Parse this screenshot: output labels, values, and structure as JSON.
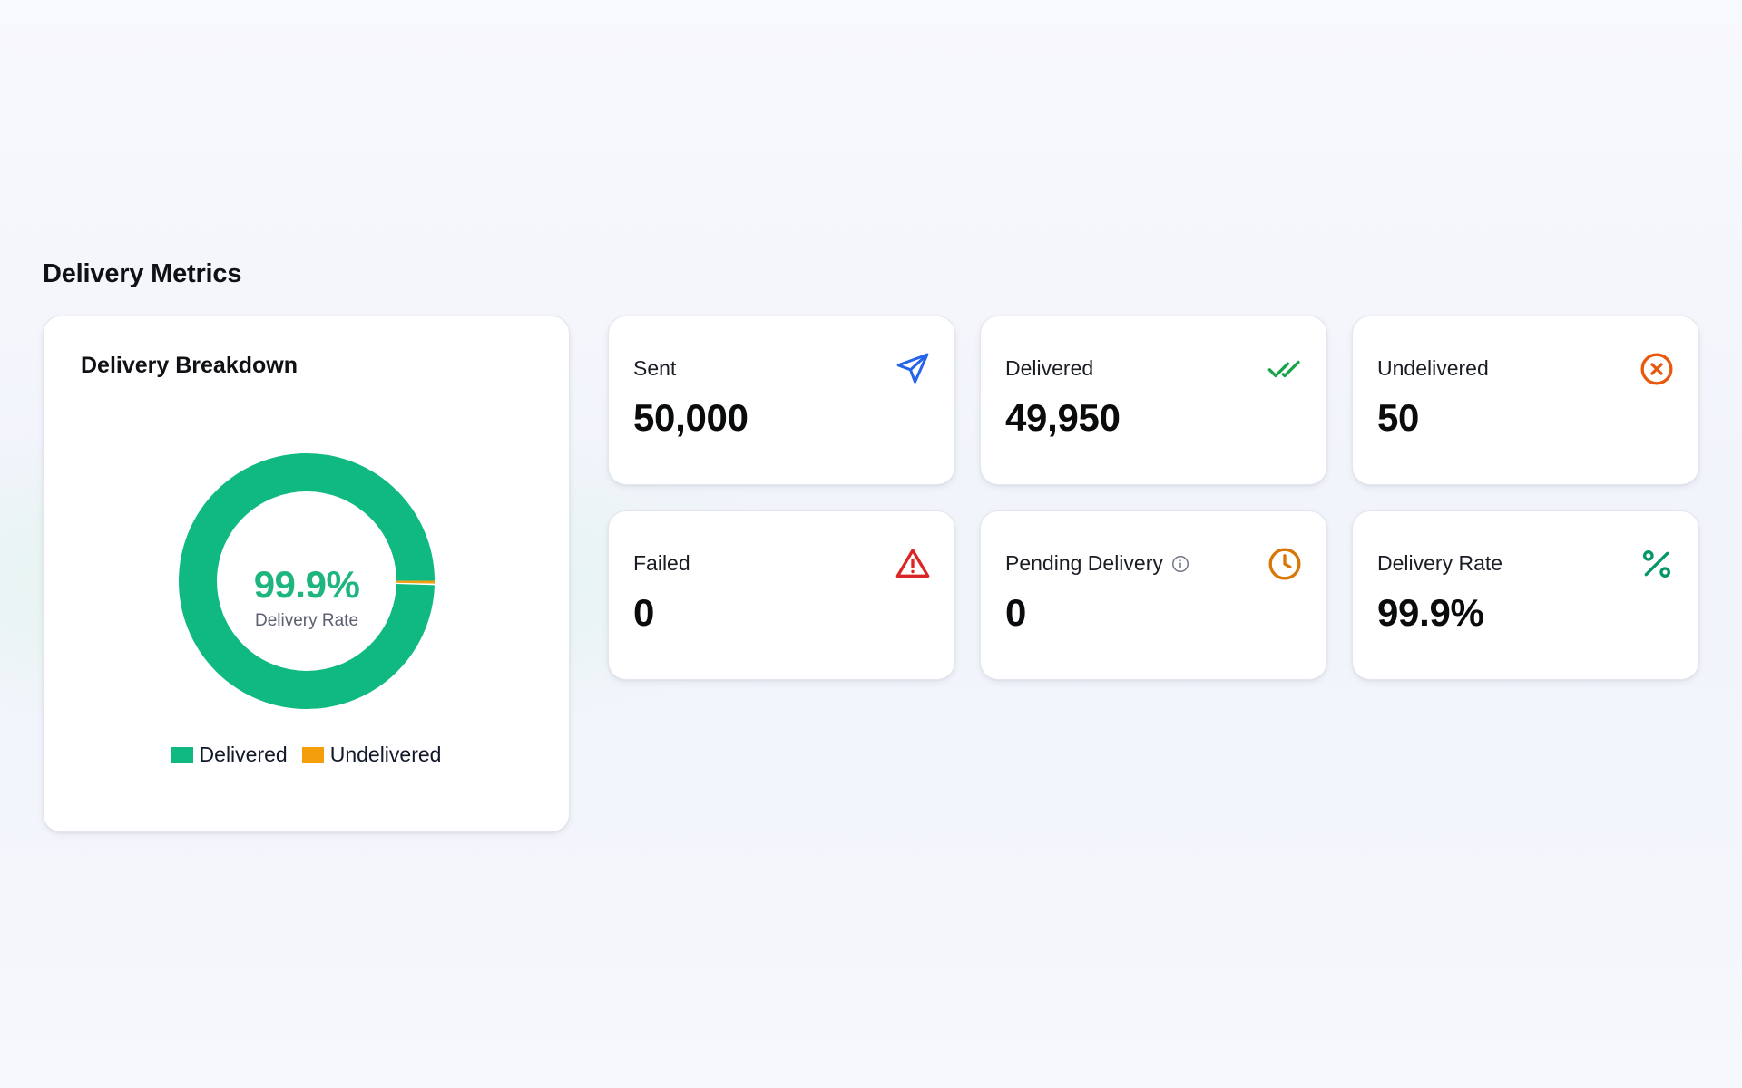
{
  "section": {
    "title": "Delivery Metrics"
  },
  "breakdown": {
    "title": "Delivery Breakdown",
    "center_value": "99.9%",
    "center_label": "Delivery Rate",
    "legend": [
      {
        "label": "Delivered",
        "color": "#10b981"
      },
      {
        "label": "Undelivered",
        "color": "#f59e0b"
      }
    ]
  },
  "chart_data": {
    "type": "pie",
    "categories": [
      "Delivered",
      "Undelivered"
    ],
    "values": [
      49950,
      50
    ],
    "colors": [
      "#10b981",
      "#f59e0b"
    ],
    "title": "Delivery Breakdown",
    "center_text": "99.9%",
    "center_subtext": "Delivery Rate",
    "legend_position": "bottom"
  },
  "stats": [
    {
      "label": "Sent",
      "value": "50,000",
      "icon": "send-icon",
      "color": "#2563eb"
    },
    {
      "label": "Delivered",
      "value": "49,950",
      "icon": "double-check-icon",
      "color": "#16a34a"
    },
    {
      "label": "Undelivered",
      "value": "50",
      "icon": "x-circle-icon",
      "color": "#ea580c"
    },
    {
      "label": "Failed",
      "value": "0",
      "icon": "warning-triangle-icon",
      "color": "#dc2626"
    },
    {
      "label": "Pending Delivery",
      "value": "0",
      "icon": "clock-icon",
      "color": "#d97706"
    },
    {
      "label": "Delivery Rate",
      "value": "99.9%",
      "icon": "percent-icon",
      "color": "#059669"
    }
  ]
}
